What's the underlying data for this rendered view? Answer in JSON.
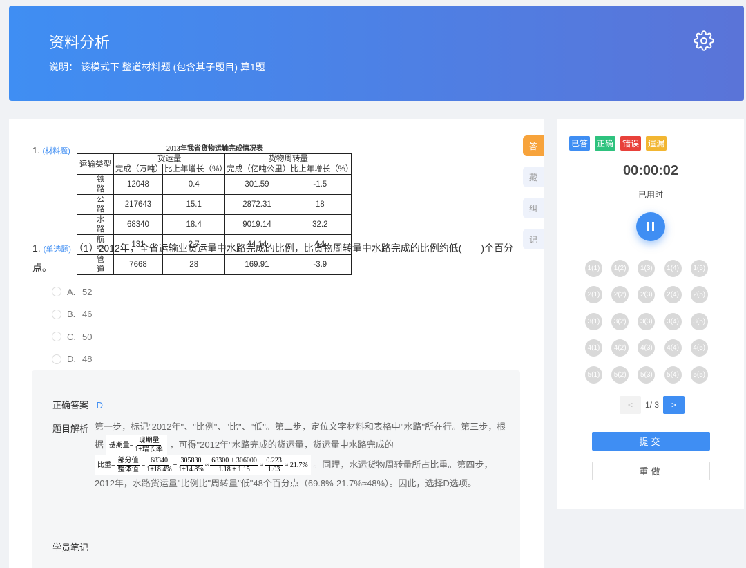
{
  "header": {
    "title": "资料分析",
    "description": "说明： 该模式下 整道材料题 (包含其子题目) 算1题"
  },
  "material": {
    "number": "1.",
    "tag": "(材料题)",
    "table_title": "2013年我省货物运输完成情况表",
    "col_type": "运输类型",
    "group1": "货运量",
    "group2": "货物周转量",
    "sub_headers": [
      "完成（万吨）",
      "比上年增长（%）",
      "完成（亿吨公里）",
      "比上年增长（%）"
    ],
    "rows": [
      [
        "铁路",
        "12048",
        "0.4",
        "301.59",
        "-1.5"
      ],
      [
        "公路",
        "217643",
        "15.1",
        "2872.31",
        "18"
      ],
      [
        "水路",
        "68340",
        "18.4",
        "9019.14",
        "32.2"
      ],
      [
        "航空",
        "131",
        "2.7",
        "44.14",
        "4.1"
      ],
      [
        "管道",
        "7668",
        "28",
        "169.91",
        "-3.9"
      ]
    ]
  },
  "question": {
    "number": "1.",
    "tag": "(单选题)",
    "stem": "（1）2012年，全省运输业货运量中水路完成的比例，比货物周转量中水路完成的比例约低(　　)个百分点。",
    "options": [
      {
        "letter": "A.",
        "text": "52"
      },
      {
        "letter": "B.",
        "text": "46"
      },
      {
        "letter": "C.",
        "text": "50"
      },
      {
        "letter": "D.",
        "text": "48"
      }
    ]
  },
  "side_tags": [
    "答",
    "藏",
    "纠",
    "记"
  ],
  "analysis": {
    "answer_label": "正确答案",
    "answer_value": "D",
    "analysis_label": "题目解析",
    "text1": "第一步，标记\"2012年\"、\"比例\"、\"比\"、\"低\"。第二步，定位文字材料和表格中\"水路\"所在行。第三步，根据",
    "text2": "，可得\"2012年\"水路完成的货运量，货运量中水路完成的",
    "text3": "。同理，水运货物周转量所占比重。第四步，2012年，水路货运量\"比例比\"周转量\"低\"48个百分点（69.8%-21.7%≈48%）。因此，选择D选项。",
    "formula1": {
      "lhs": "基期量=",
      "num": "现期量",
      "den": "1+增长率"
    },
    "formula2": {
      "lhs": "比重=",
      "f1n": "部分值",
      "f1d": "整体值",
      "f2n": "68340",
      "f2d": "1+18.4%",
      "div": "÷",
      "f3n": "305830",
      "f3d": "1+14.8%",
      "approx": "≈",
      "f4n": "68300 + 306000",
      "f4d": "1.18 + 1.15",
      "f5n": "0.223",
      "f5d": "1.03",
      "result": "≈ 21.7%"
    },
    "notes_label": "学员笔记"
  },
  "panel": {
    "legend": [
      {
        "label": "已答",
        "color": "#3f8ef3"
      },
      {
        "label": "正确",
        "color": "#2ec27e"
      },
      {
        "label": "错误",
        "color": "#e8413a"
      },
      {
        "label": "遗漏",
        "color": "#f2b632"
      }
    ],
    "timer": "00:00:02",
    "timer_label": "已用时",
    "cells": [
      "1(1)",
      "1(2)",
      "1(3)",
      "1(4)",
      "1(5)",
      "2(1)",
      "2(2)",
      "2(3)",
      "2(4)",
      "2(5)",
      "3(1)",
      "3(2)",
      "3(3)",
      "3(4)",
      "3(5)",
      "4(1)",
      "4(2)",
      "4(3)",
      "4(4)",
      "4(5)",
      "5(1)",
      "5(2)",
      "5(3)",
      "5(4)",
      "5(5)"
    ],
    "pager": {
      "prev": "<",
      "info": "1/ 3",
      "next": ">"
    },
    "submit": "提交",
    "redo": "重做"
  }
}
